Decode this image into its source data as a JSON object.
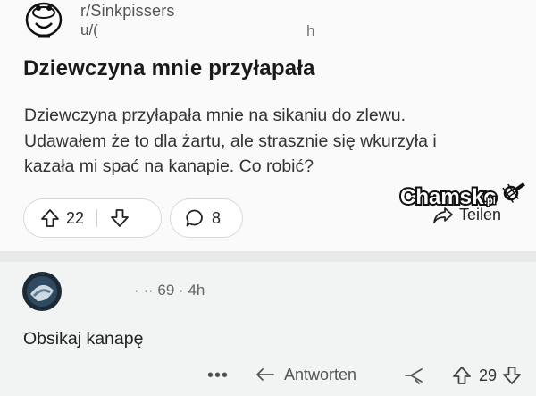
{
  "post": {
    "subreddit": "r/Sinkpissers",
    "user": "u/(",
    "header_extra": "h",
    "title": "Dziewczyna mnie przyłapała",
    "body_lines": [
      "Dziewczyna przyłapała mnie na sikaniu do zlewu.",
      "Udawałem że to dla żartu, ale strasznie się wkurzyła i",
      "kazała mi spać na kanapie. Co robić?"
    ],
    "upvotes": "22",
    "comments": "8",
    "share_label": "Teilen"
  },
  "watermark": {
    "text": "Chamsko",
    "suffix": ".pl"
  },
  "comment": {
    "meta": "· ·· 69 · 4h",
    "text": "Obsikaj kanapę",
    "more": "•••",
    "reply_label": "Antworten",
    "votes": "29"
  },
  "colors": {
    "post_background": "#fafafa",
    "comment_background": "#f2f3f3",
    "border": "#d8d8d8"
  },
  "icons": {
    "subreddit": "toilet-mascot-icon",
    "upvote": "arrow-up-icon",
    "downvote": "arrow-down-icon",
    "comment": "speech-bubble-icon",
    "share": "share-arrow-icon",
    "reply": "reply-arrow-icon",
    "award": "award-icon"
  }
}
